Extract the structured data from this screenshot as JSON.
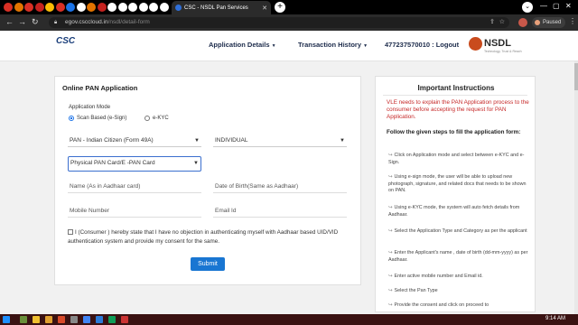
{
  "browser": {
    "tab_title": "CSC - NSDL Pan Services",
    "url_host": "egov.csccloud.in",
    "url_path": "/nsdl/detail-form",
    "profile_status": "Paused",
    "pinned_tab_colors": [
      "#d93025",
      "#e37400",
      "#d93025",
      "#c5221f",
      "#fbbc04",
      "#d93025",
      "#1a73e8",
      "#ffffff",
      "#e37400",
      "#c5221f",
      "#ffffff",
      "#ffffff",
      "#ffffff",
      "#ffffff",
      "#ffffff",
      "#ffffff"
    ]
  },
  "header": {
    "logo_text": "CSC",
    "nav": {
      "application_details": "Application Details",
      "transaction_history": "Transaction History",
      "account": "477237570010 : Logout"
    },
    "nsdl_logo": {
      "name": "NSDL",
      "tagline": "Technology, Trust & Reach"
    }
  },
  "form": {
    "title": "Online PAN Application",
    "application_mode_label": "Application Mode",
    "mode_options": [
      "Scan Based (e-Sign)",
      "e-KYC"
    ],
    "mode_selected": "Scan Based (e-Sign)",
    "application_type": "PAN - Indian Citizen (Form 49A)",
    "category": "INDIVIDUAL",
    "pan_type": "Physical PAN Card/E -PAN Card",
    "name_placeholder": "Name (As in Aadhaar card)",
    "dob_placeholder": "Date of Birth(Same as Aadhaar)",
    "mobile_placeholder": "Mobile Number",
    "email_placeholder": "Email Id",
    "consent_text": "I (Consumer ) hereby state that I have no objection in authenticating myself with Aadhaar based UID/VID authentication system and provide my consent for the same.",
    "submit_label": "Submit"
  },
  "instructions": {
    "title": "Important Instructions",
    "notice": "VLE needs to explain the PAN Application process to the consumer before accepting the request for PAN Application.",
    "follow_heading": "Follow the given steps to fill the application form:",
    "steps": [
      "Click on Application mode and select between e-KYC and e-Sign.",
      "Using e-sign mode, the user will be able to upload new photograph, signature, and related docs that needs to be shown on PAN.",
      "Using e-KYC mode, the system will auto fetch details from Aadhaar.",
      "Select the Application Type and Category as per the applicant",
      "Enter the Applicant's name , date of birth (dd-mm-yyyy) as per Aadhaar.",
      "Enter active mobile number and Email id.",
      "Select the Pan Type",
      "Provide the consent and click on proceed to"
    ]
  },
  "taskbar": {
    "time": "9:14 AM"
  }
}
